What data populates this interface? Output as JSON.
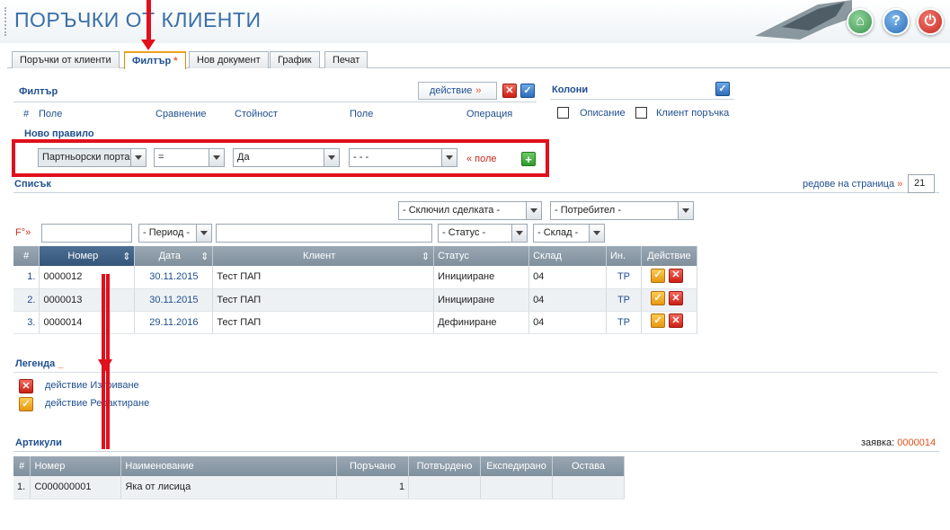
{
  "header": {
    "title": "ПОРЪЧКИ ОТ КЛИЕНТИ",
    "buttons": [
      "home-icon",
      "help-icon",
      "power-icon"
    ]
  },
  "tabs": [
    {
      "label": "Поръчки от клиенти",
      "active": false
    },
    {
      "label": "Филтър",
      "active": true,
      "mark": "*"
    },
    {
      "label": "Нов документ",
      "active": false
    },
    {
      "label": "График",
      "active": false
    },
    {
      "label": "Печат",
      "active": false
    }
  ],
  "filter": {
    "title": "Филтър",
    "action_label": "действие",
    "action_arrow": "»",
    "columns_head": [
      "#",
      "Поле",
      "Сравнение",
      "Стойност",
      "Поле",
      "Операция"
    ],
    "new_rule_label": "Ново правило",
    "rule": {
      "field": "Партньорски порта",
      "comparison": "=",
      "value": "Да",
      "next_field": "- - -",
      "add_field_link": "« поле"
    }
  },
  "columns": {
    "title": "Колони",
    "options": [
      {
        "label": "Описание",
        "checked": false
      },
      {
        "label": "Клиент поръчка",
        "checked": false
      }
    ]
  },
  "list": {
    "title": "Списък",
    "rows_per_page_label": "редове на страница",
    "rows_per_page_arrow": "»",
    "rows_per_page": "21",
    "filter_selects": {
      "closed_by": "- Сключил сделката -",
      "user": "- Потребител -",
      "period": "- Период -",
      "status": "- Статус -",
      "warehouse": "- Склад -"
    },
    "f_label": "F°»",
    "headers": [
      "#",
      "Номер",
      "Дата",
      "Клиент",
      "Статус",
      "Склад",
      "Ин.",
      "Действие"
    ],
    "rows": [
      {
        "n": "1.",
        "number": "0000012",
        "date": "30.11.2015",
        "client": "Тест ПАП",
        "status": "Иницииране",
        "warehouse": "04",
        "in": "ТР"
      },
      {
        "n": "2.",
        "number": "0000013",
        "date": "30.11.2015",
        "client": "Тест ПАП",
        "status": "Иницииране",
        "warehouse": "04",
        "in": "ТР"
      },
      {
        "n": "3.",
        "number": "0000014",
        "date": "29.11.2016",
        "client": "Тест ПАП",
        "status": "Дефиниране",
        "warehouse": "04",
        "in": "ТР"
      }
    ]
  },
  "legend": {
    "title": "Легенда",
    "items": [
      {
        "icon": "delete-icon",
        "label": "действие Изтриване"
      },
      {
        "icon": "edit-icon",
        "label": "действие Редактиране"
      }
    ]
  },
  "articles": {
    "title": "Артикули",
    "request_label": "заявка:",
    "request_number": "0000014",
    "headers": [
      "#",
      "Номер",
      "Наименование",
      "Поръчано",
      "Потвърдено",
      "Експедирано",
      "Остава"
    ],
    "rows": [
      {
        "n": "1.",
        "number": "C000000001",
        "name": "Яка от лисица",
        "ordered": "1",
        "confirmed": "",
        "shipped": "",
        "remaining": ""
      }
    ]
  },
  "colors": {
    "accent": "#1f4f8f",
    "annotation": "#e0101c",
    "header_row": "#8494a1"
  }
}
